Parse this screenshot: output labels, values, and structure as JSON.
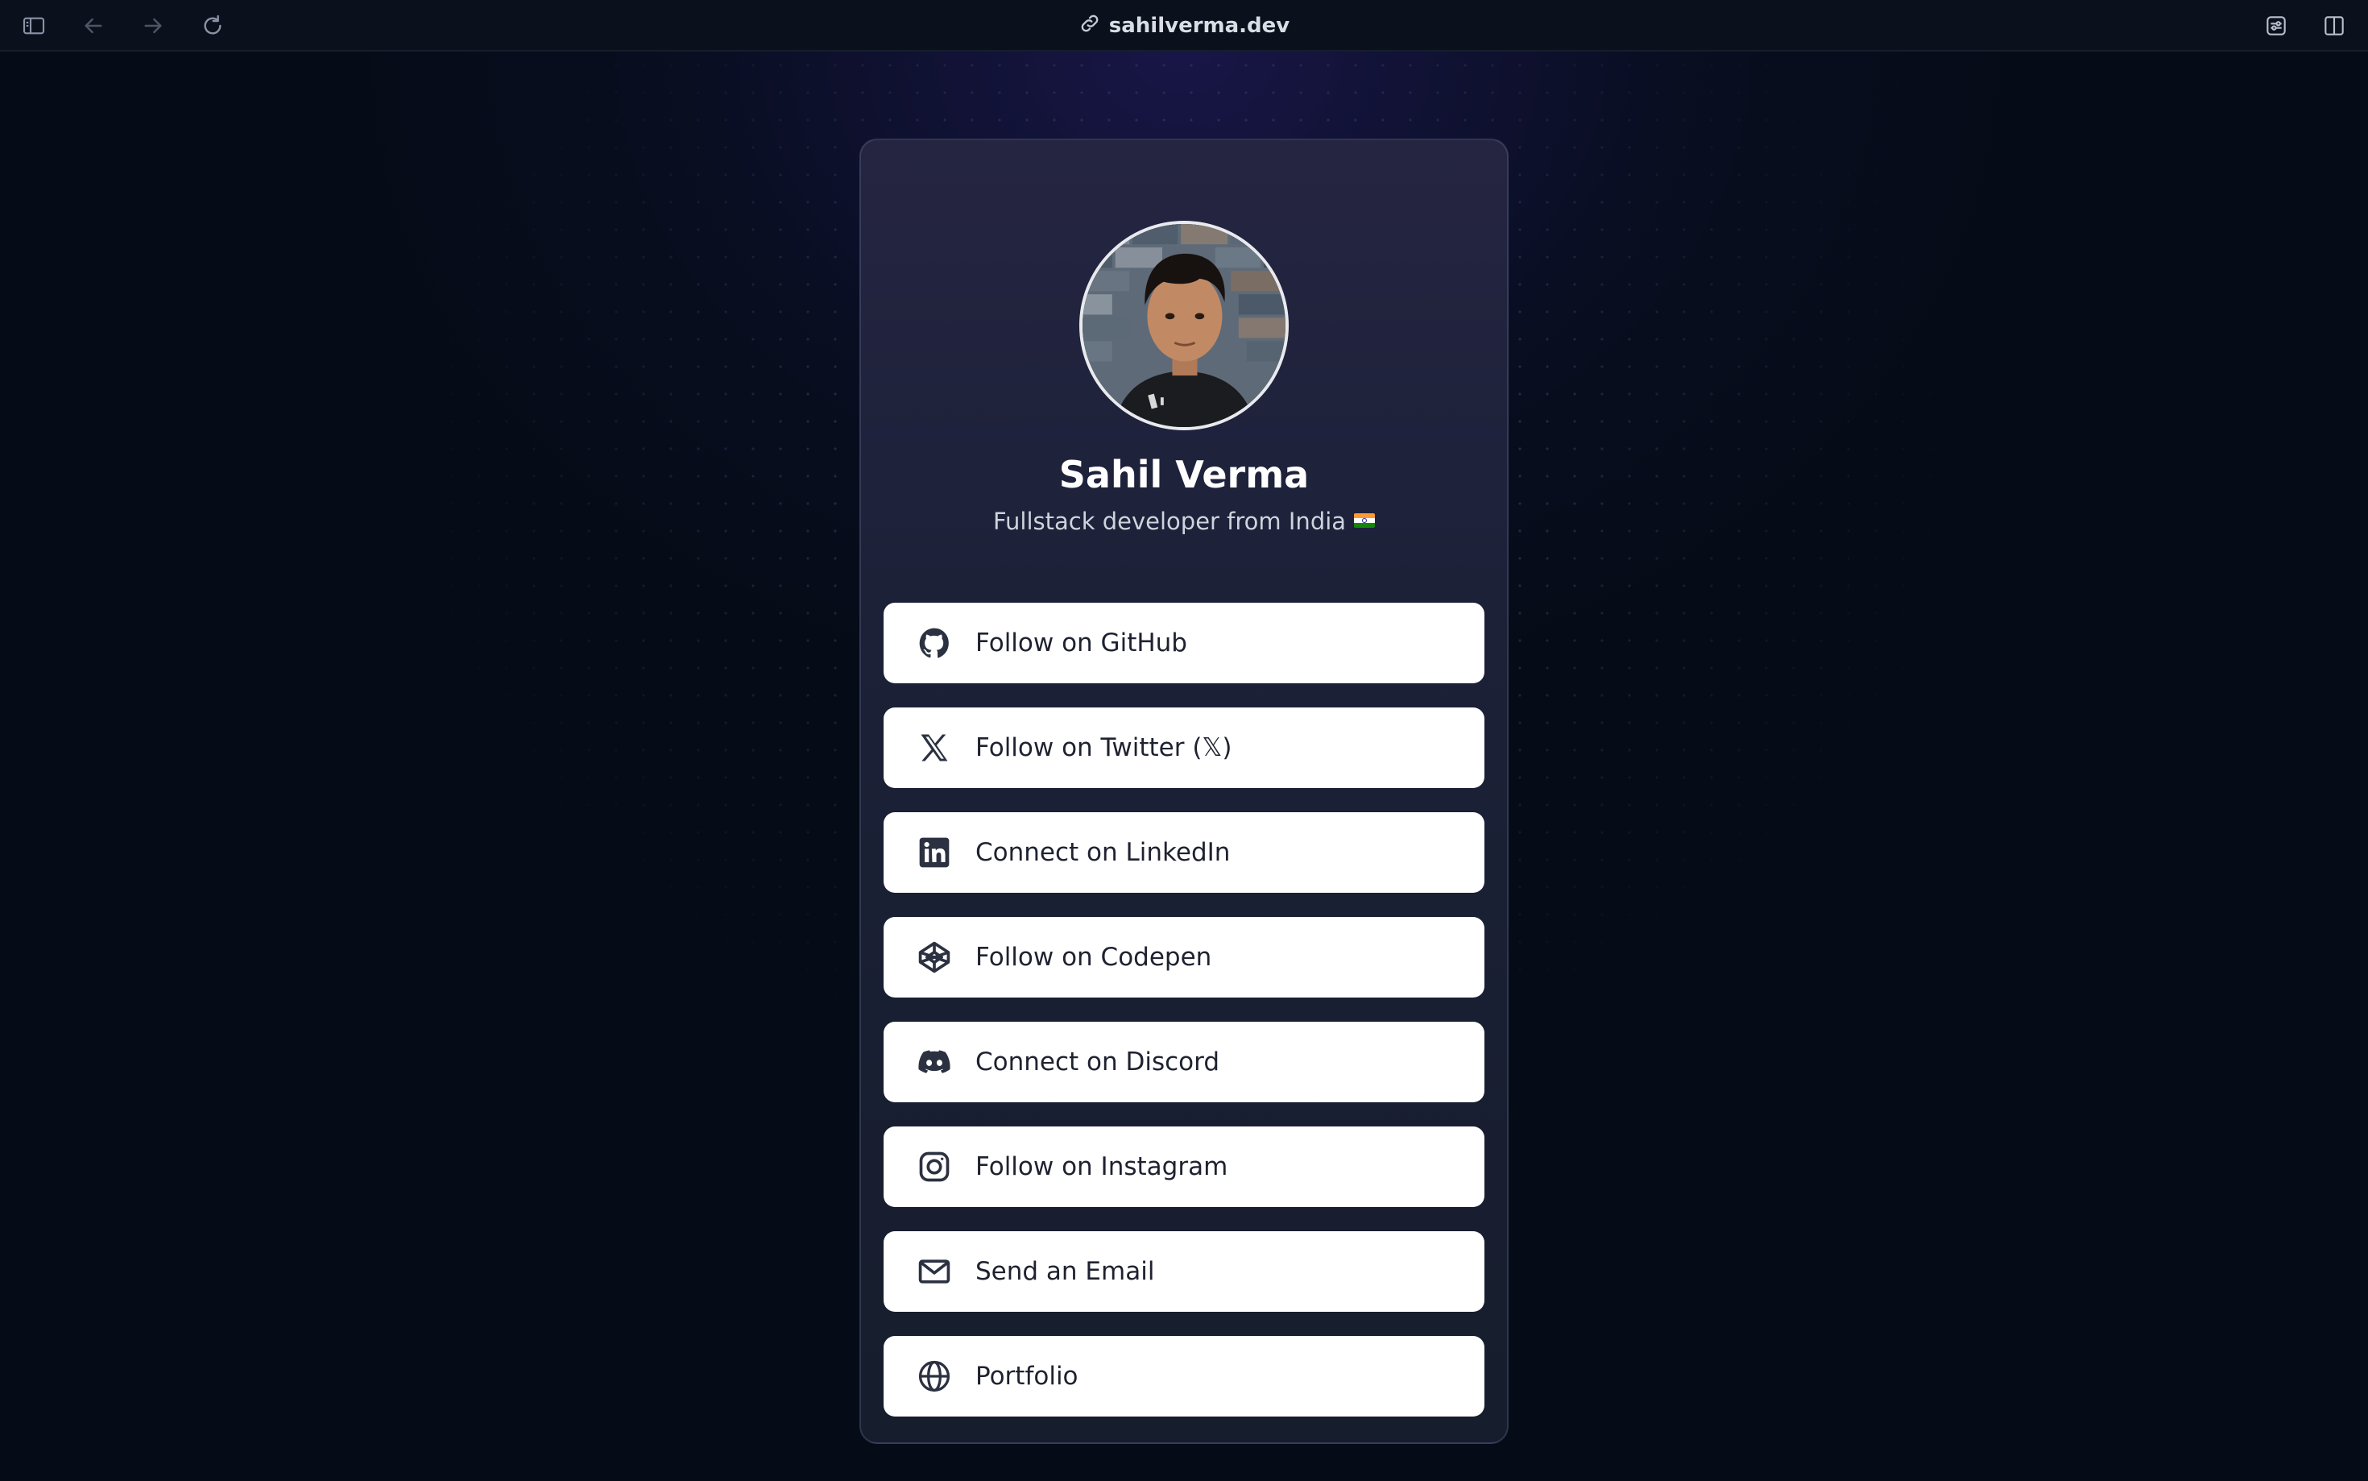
{
  "browser": {
    "url": "sahilverma.dev",
    "icons": {
      "sidebar": "sidebar-icon",
      "back": "back-arrow-icon",
      "forward": "forward-arrow-icon",
      "reload": "reload-icon",
      "link": "link-icon",
      "extension": "extension-icon",
      "split_view": "split-view-icon"
    }
  },
  "profile": {
    "name": "Sahil Verma",
    "tagline": "Fullstack developer from India",
    "flag": "india-flag"
  },
  "links": [
    {
      "label": "Follow on GitHub",
      "icon": "github-icon"
    },
    {
      "label": "Follow on Twitter (𝕏)",
      "icon": "x-icon"
    },
    {
      "label": "Connect on LinkedIn",
      "icon": "linkedin-icon"
    },
    {
      "label": "Follow on Codepen",
      "icon": "codepen-icon"
    },
    {
      "label": "Connect on Discord",
      "icon": "discord-icon"
    },
    {
      "label": "Follow on Instagram",
      "icon": "instagram-icon"
    },
    {
      "label": "Send an Email",
      "icon": "mail-icon"
    },
    {
      "label": "Portfolio",
      "icon": "globe-icon"
    }
  ],
  "colors": {
    "background": "#050c17",
    "card": "#1c2138",
    "button": "#ffffff",
    "button_text": "#1e2230"
  }
}
